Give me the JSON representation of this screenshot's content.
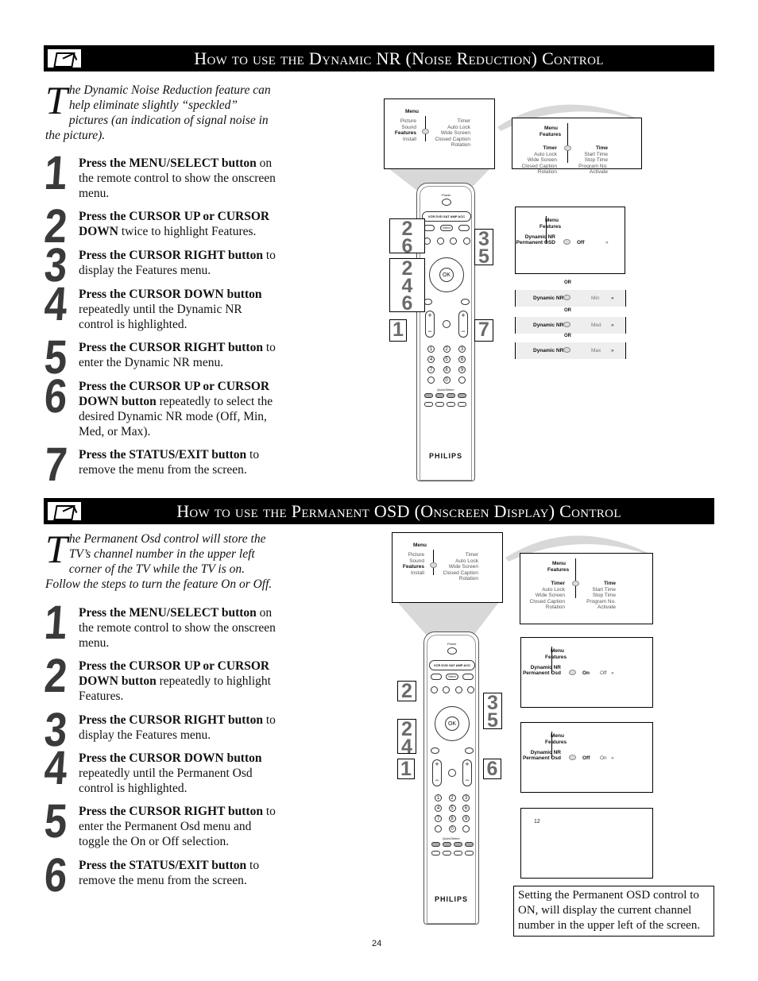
{
  "section1": {
    "title": "How to use the Dynamic NR (Noise Reduction) Control",
    "intro_dropcap": "T",
    "intro": "he Dynamic Noise Reduction feature can help eliminate slightly “speckled” pictures (an indication of signal noise in the picture).",
    "steps": [
      {
        "n": "1",
        "bold": "Press the MENU/SELECT button",
        "text": " on the remote control to show the onscreen menu."
      },
      {
        "n": "2",
        "bold": "Press the CURSOR UP or CURSOR DOWN",
        "text": " twice to highlight Features."
      },
      {
        "n": "3",
        "bold": "Press the CURSOR RIGHT button",
        "text": " to display the Features menu."
      },
      {
        "n": "4",
        "bold": "Press the CURSOR DOWN button",
        "text": " repeatedly until the Dynamic NR control is highlighted."
      },
      {
        "n": "5",
        "bold": "Press the CURSOR RIGHT button",
        "text": " to enter the Dynamic NR menu."
      },
      {
        "n": "6",
        "bold": "Press the CURSOR UP or CURSOR DOWN button",
        "text": " repeatedly to select the desired Dynamic NR mode (Off, Min, Med, or Max)."
      },
      {
        "n": "7",
        "bold": "Press the STATUS/EXIT button",
        "text": " to remove the menu from the screen."
      }
    ],
    "callouts": [
      "2 6",
      "2 4 6",
      "1",
      "3 5",
      "7"
    ],
    "or_label": "OR",
    "dnr_label": "Dynamic NR",
    "perm_label": "Permanent OSD",
    "modes": [
      "Off",
      "Min",
      "Med",
      "Max"
    ],
    "arrow": "»"
  },
  "menu": {
    "title": "Menu",
    "left": [
      "Picture",
      "Sound",
      "Features",
      "Install"
    ],
    "right": [
      "Timer",
      "Auto Lock",
      "Wide Screen",
      "Closed Caption",
      "Rotation"
    ],
    "features_title": "Features",
    "feat_left": [
      "Timer",
      "Auto Lock",
      "Wide Screen",
      "Closed Caption",
      "Rotation"
    ],
    "feat_right": [
      "Time",
      "Start Time",
      "Stop Time",
      "Program No.",
      "Activate"
    ]
  },
  "section2": {
    "title": "How to use the Permanent OSD (Onscreen Display) Control",
    "intro_dropcap": "T",
    "intro": "he Permanent Osd control will store the TV’s channel number in the upper left corner of the TV while the TV is on.  Follow the steps to turn the feature On or Off.",
    "steps": [
      {
        "n": "1",
        "bold": "Press the MENU/SELECT button",
        "text": " on the remote control to show the onscreen menu."
      },
      {
        "n": "2",
        "bold": "Press the CURSOR UP or CURSOR DOWN button",
        "text": " repeatedly to highlight Features."
      },
      {
        "n": "3",
        "bold": "Press the CURSOR RIGHT button",
        "text": " to display the Features menu."
      },
      {
        "n": "4",
        "bold": "Press the CURSOR DOWN button",
        "text": " repeatedly until the Permanent Osd control is highlighted."
      },
      {
        "n": "5",
        "bold": "Press the CURSOR RIGHT button",
        "text": " to enter the Permanent Osd menu and toggle the On or Off selection."
      },
      {
        "n": "6",
        "bold": "Press the STATUS/EXIT button",
        "text": " to remove the menu from the screen."
      }
    ],
    "callouts": [
      "2",
      "2 4",
      "1",
      "3 5",
      "6"
    ],
    "dnr_label": "Dynamic NR",
    "perm_label": "Permanent Osd",
    "on": "On",
    "off": "Off",
    "channel": "12",
    "caption": "Setting the Permanent OSD control to ON, will display the current channel number in the upper left of the screen."
  },
  "remote": {
    "power": "Power",
    "sources": "VCR DVD SAT AMP ACC",
    "select": "Select",
    "ok": "OK",
    "keys": [
      "1",
      "2",
      "3",
      "4",
      "5",
      "6",
      "7",
      "8",
      "9",
      "",
      "0",
      ""
    ],
    "brand": "PHILIPS",
    "brand_sub": "QuickSelect"
  },
  "page_number": "24"
}
